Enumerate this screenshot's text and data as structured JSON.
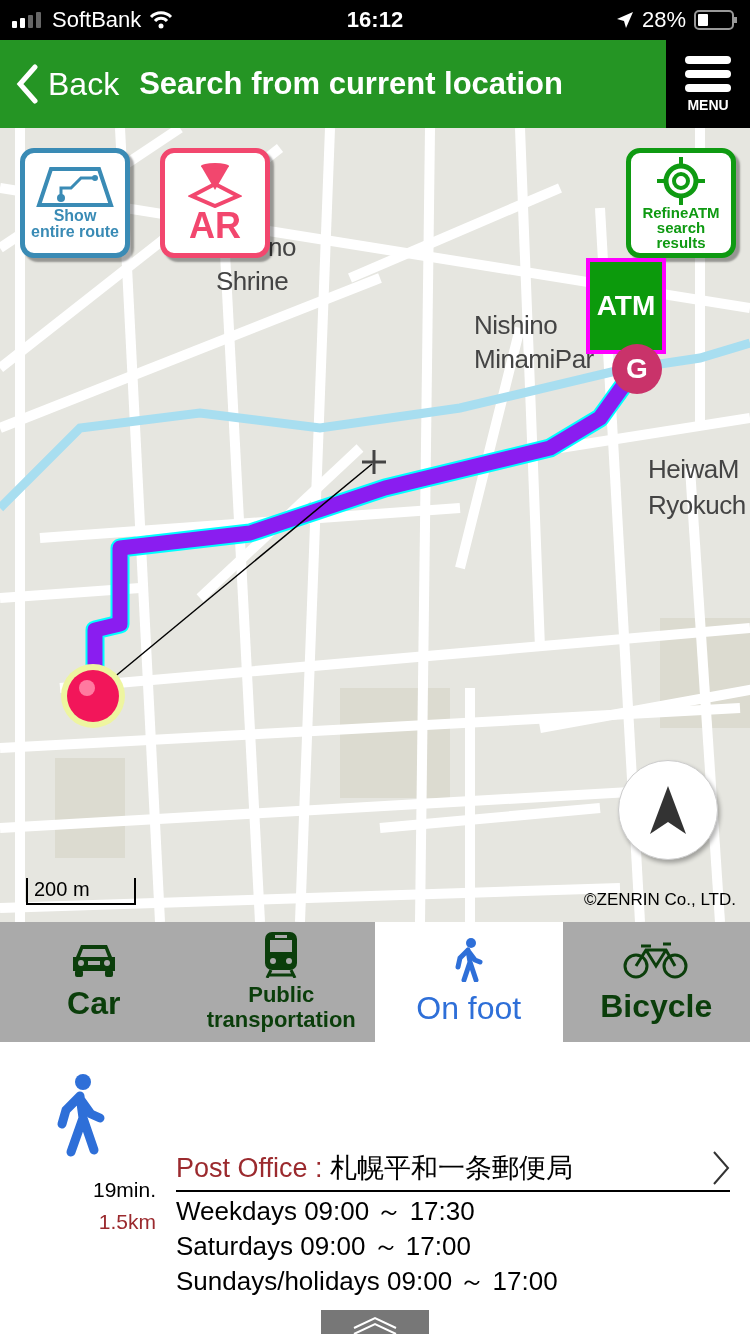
{
  "status_bar": {
    "carrier": "SoftBank",
    "time": "16:12",
    "battery": "28%"
  },
  "header": {
    "back": "Back",
    "title": "Search from current location",
    "menu": "MENU"
  },
  "map": {
    "buttons": [
      {
        "kind": "route",
        "label": "Show\nentire route"
      },
      {
        "kind": "ar",
        "label": "AR"
      },
      {
        "kind": "refine",
        "label": "RefineATM\nsearch\nresults"
      }
    ],
    "labels": [
      "no",
      "Shrine",
      "Nishino",
      "MinamiPar",
      "HeiwaM",
      "Ryokuch"
    ],
    "atm_marker": "ATM",
    "goal_marker": "G",
    "scale": "200 m",
    "copyright": "©ZENRIN Co., LTD."
  },
  "tabs": [
    {
      "kind": "car",
      "label": "Car",
      "selected": false
    },
    {
      "kind": "train",
      "label": "Public\ntransportation",
      "selected": false
    },
    {
      "kind": "walk",
      "label": "On foot",
      "selected": true
    },
    {
      "kind": "bicycle",
      "label": "Bicycle",
      "selected": false
    }
  ],
  "result": {
    "time": "19min.",
    "distance": "1.5km",
    "category": "Post Office :",
    "name": "札幌平和一条郵便局",
    "hours": [
      "Weekdays 09:00 ～ 17:30",
      "Saturdays 09:00 ～ 17:00",
      "Sundays/holidays 09:00 ～ 17:00"
    ]
  }
}
